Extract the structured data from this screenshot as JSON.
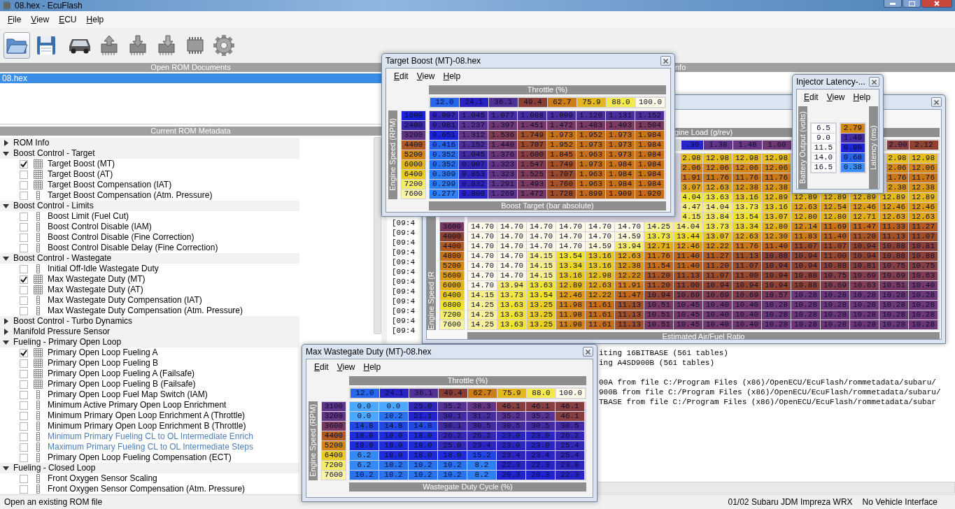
{
  "window": {
    "title": "08.hex - EcuFlash"
  },
  "menu": [
    "File",
    "View",
    "ECU",
    "Help"
  ],
  "documents": {
    "header": "Open ROM Documents",
    "items": [
      {
        "label": "08.hex",
        "selected": true
      }
    ]
  },
  "metadata": {
    "header": "Current ROM Metadata",
    "tree": [
      {
        "label": "ROM Info",
        "expanded": false
      },
      {
        "label": "Boost Control - Target",
        "expanded": true,
        "children": [
          {
            "label": "Target Boost (MT)",
            "checked": true,
            "kind": "grid",
            "highlighted": false
          },
          {
            "label": "Target Boost (AT)",
            "checked": false,
            "kind": "grid",
            "highlighted": false
          },
          {
            "label": "Target Boost Compensation (IAT)",
            "checked": false,
            "kind": "grid",
            "highlighted": false
          },
          {
            "label": "Target Boost Compensation (Atm. Pressure)",
            "checked": false,
            "kind": "column",
            "highlighted": false
          }
        ]
      },
      {
        "label": "Boost Control - Limits",
        "expanded": true,
        "children": [
          {
            "label": "Boost Limit (Fuel Cut)",
            "checked": false,
            "kind": "column",
            "highlighted": false
          },
          {
            "label": "Boost Control Disable (IAM)",
            "checked": false,
            "kind": "column",
            "highlighted": false
          },
          {
            "label": "Boost Control Disable (Fine Correction)",
            "checked": false,
            "kind": "column",
            "highlighted": false
          },
          {
            "label": "Boost Control Disable Delay (Fine Correction)",
            "checked": false,
            "kind": "column",
            "highlighted": false
          }
        ]
      },
      {
        "label": "Boost Control - Wastegate",
        "expanded": true,
        "children": [
          {
            "label": "Initial Off-Idle Wastegate Duty",
            "checked": false,
            "kind": "column",
            "highlighted": false
          },
          {
            "label": "Max Wastegate Duty (MT)",
            "checked": true,
            "kind": "grid",
            "highlighted": false
          },
          {
            "label": "Max Wastegate Duty (AT)",
            "checked": false,
            "kind": "grid",
            "highlighted": false
          },
          {
            "label": "Max Wastegate Duty Compensation (IAT)",
            "checked": false,
            "kind": "column",
            "highlighted": false
          },
          {
            "label": "Max Wastegate Duty Compensation (Atm. Pressure)",
            "checked": false,
            "kind": "column",
            "highlighted": false
          }
        ]
      },
      {
        "label": "Boost Control - Turbo Dynamics",
        "expanded": false
      },
      {
        "label": "Manifold Pressure Sensor",
        "expanded": false
      },
      {
        "label": "Fueling - Primary Open Loop",
        "expanded": true,
        "children": [
          {
            "label": "Primary Open Loop Fueling A",
            "checked": true,
            "kind": "grid",
            "highlighted": false
          },
          {
            "label": "Primary Open Loop Fueling B",
            "checked": false,
            "kind": "grid",
            "highlighted": false
          },
          {
            "label": "Primary Open Loop Fueling A (Failsafe)",
            "checked": false,
            "kind": "grid",
            "highlighted": false
          },
          {
            "label": "Primary Open Loop Fueling B (Failsafe)",
            "checked": false,
            "kind": "grid",
            "highlighted": false
          },
          {
            "label": "Primary Open Loop Fuel Map Switch (IAM)",
            "checked": false,
            "kind": "column",
            "highlighted": false
          },
          {
            "label": "Minimum Active Primary Open Loop Enrichment",
            "checked": false,
            "kind": "column",
            "highlighted": false
          },
          {
            "label": "Minimum Primary Open Loop Enrichment A (Throttle)",
            "checked": false,
            "kind": "column",
            "highlighted": false
          },
          {
            "label": "Minimum Primary Open Loop Enrichment B (Throttle)",
            "checked": false,
            "kind": "column",
            "highlighted": false
          },
          {
            "label": "Minimum Primary Fueling CL to OL Intermediate Enrich",
            "checked": false,
            "kind": "column",
            "highlighted": true
          },
          {
            "label": "Maximum Primary Fueling CL to OL Intermediate Steps",
            "checked": false,
            "kind": "column",
            "highlighted": true
          },
          {
            "label": "Primary Open Loop Fueling Compensation (ECT)",
            "checked": false,
            "kind": "column",
            "highlighted": false
          }
        ]
      },
      {
        "label": "Fueling - Closed Loop",
        "expanded": true,
        "children": [
          {
            "label": "Front Oxygen Sensor Scaling",
            "checked": false,
            "kind": "column",
            "highlighted": false
          },
          {
            "label": "Front Oxygen Sensor Compensation (Atm. Pressure)",
            "checked": false,
            "kind": "column",
            "highlighted": false
          }
        ]
      }
    ]
  },
  "right_pane": {
    "header": "nfo",
    "log_left": [
      "[09:4",
      "[09:4",
      "[09:4",
      "[09:4",
      "[09:4",
      "[09:4",
      "[09:4",
      "[09:4",
      "[09:4",
      "[09:4",
      "[09:4",
      "[09:4"
    ],
    "log_tail": [
      [
        "iting 16BITBASE (561 tables)",
        "ing A4SD900B (561 tables)"
      ],
      [
        "00A from file C:/Program Files (x86)/OpenECU/EcuFlash/rommetadata/subaru/",
        "900B from file C:/Program Files (x86)/OpenECU/EcuFlash/rommetadata/subaru/",
        "TBASE from file C:/Program Files (x86)/OpenECU/EcuFlash/rommetadata/subar"
      ]
    ]
  },
  "windows": [
    {
      "kind": "air-fuel-map",
      "x_axis": {
        "title": "gine Load (g/rev)",
        "values": [
          [
            ".30",
            "1.38",
            "1.48",
            "1.60"
          ],
          [
            "2.00",
            "2.12"
          ]
        ]
      },
      "y_axis": {
        "title": "Engine Speed (R",
        "values": [
          [
            "3600",
            "4000",
            "4400",
            "4800",
            "5200",
            "5600",
            "6000",
            "6400",
            "6800",
            "7200",
            "7600"
          ]
        ]
      },
      "data": {
        "title": "Estimated Air/Fuel Ratio",
        "rows": [
          [
            [
              "2.98",
              "12.98",
              "12.98",
              "12.98"
            ],
            [
              "2.98",
              "12.98"
            ]
          ],
          [
            [
              "2.06",
              "12.06",
              "12.06",
              "12.06"
            ],
            [
              "2.06",
              "12.06"
            ]
          ],
          [
            [
              "1.91",
              "11.76",
              "11.76",
              "11.76"
            ],
            [
              "1.76",
              "11.76"
            ]
          ],
          [
            [
              "3.07",
              "12.63",
              "12.38",
              "12.38"
            ],
            [
              "2.38",
              "12.38"
            ]
          ],
          [
            [
              "4.04",
              "13.63",
              "13.16",
              "12.89",
              "12.89",
              "12.89",
              "12.89",
              "12.89",
              "12.89"
            ]
          ],
          [
            [
              "4.47",
              "14.04",
              "13.73",
              "13.16",
              "12.63",
              "12.54",
              "12.46",
              "12.46",
              "12.46"
            ]
          ],
          [
            [
              "4.15",
              "13.84",
              "13.54",
              "13.07",
              "12.80",
              "12.80",
              "12.71",
              "12.63",
              "12.63"
            ]
          ],
          [
            [
              "14.70",
              "14.70",
              "14.70",
              "14.70",
              "14.70",
              "14.70",
              "14.25",
              "14.04",
              "13.73",
              "13.34",
              "12.80",
              "12.14",
              "11.69",
              "11.47",
              "11.33",
              "11.27"
            ]
          ],
          [
            [
              "14.70",
              "14.70",
              "14.70",
              "14.70",
              "14.70",
              "14.59",
              "13.73",
              "13.44",
              "13.07",
              "12.63",
              "12.30",
              "11.83",
              "11.40",
              "11.20",
              "11.13",
              "11.07"
            ]
          ],
          [
            [
              "14.70",
              "14.70",
              "14.70",
              "14.70",
              "14.59",
              "13.94",
              "12.71",
              "12.46",
              "12.22",
              "11.76",
              "11.40",
              "11.07",
              "11.07",
              "10.94",
              "10.88",
              "10.81"
            ]
          ],
          [
            [
              "14.70",
              "14.70",
              "14.15",
              "13.54",
              "13.16",
              "12.63",
              "11.76",
              "11.40",
              "11.27",
              "11.13",
              "10.88",
              "10.94",
              "11.00",
              "10.94",
              "10.88",
              "10.88"
            ]
          ],
          [
            [
              "14.70",
              "14.70",
              "14.15",
              "13.34",
              "13.16",
              "12.38",
              "11.54",
              "11.40",
              "11.20",
              "11.07",
              "10.94",
              "10.94",
              "10.88",
              "10.81",
              "10.75",
              "10.75"
            ]
          ],
          [
            [
              "14.70",
              "14.70",
              "14.15",
              "13.16",
              "12.98",
              "12.22",
              "11.20",
              "11.13",
              "11.07",
              "11.00",
              "10.94",
              "10.88",
              "10.75",
              "10.69",
              "10.69",
              "10.63"
            ]
          ],
          [
            [
              "14.70",
              "13.94",
              "13.63",
              "12.89",
              "12.63",
              "11.91",
              "11.20",
              "11.00",
              "10.94",
              "10.94",
              "10.94",
              "10.88",
              "10.69",
              "10.63",
              "10.51",
              "10.40"
            ]
          ],
          [
            [
              "14.15",
              "13.73",
              "13.54",
              "12.46",
              "12.22",
              "11.47",
              "10.94",
              "10.69",
              "10.69",
              "10.69",
              "10.57",
              "10.28",
              "10.28",
              "10.28",
              "10.28",
              "10.28"
            ]
          ],
          [
            [
              "14.25",
              "13.63",
              "13.25",
              "11.98",
              "11.61",
              "11.13",
              "10.51",
              "10.45",
              "10.40",
              "10.40",
              "10.28",
              "10.28",
              "10.28",
              "10.28",
              "10.28",
              "10.28"
            ]
          ],
          [
            [
              "14.25",
              "13.63",
              "13.25",
              "11.98",
              "11.61",
              "11.13",
              "10.51",
              "10.45",
              "10.40",
              "10.40",
              "10.28",
              "10.28",
              "10.28",
              "10.28",
              "10.28",
              "10.28"
            ]
          ],
          [
            [
              "14.25",
              "13.63",
              "13.25",
              "11.98",
              "11.61",
              "11.13",
              "10.51",
              "10.45",
              "10.40",
              "10.40",
              "10.28",
              "10.28",
              "10.28",
              "10.28",
              "10.28",
              "10.28"
            ]
          ]
        ]
      }
    },
    {
      "kind": "boost-map",
      "title": "Target Boost (MT)-08.hex",
      "menu": [
        "Edit",
        "View",
        "Help"
      ],
      "x_axis": {
        "title": "Throttle (%)",
        "values": [
          [
            "12.0",
            "24.1",
            "36.1",
            "49.4",
            "62.7",
            "75.9",
            "88.0",
            "100.0"
          ]
        ]
      },
      "y_axis": {
        "title": "Engine Speed (RPM)",
        "values": [
          [
            "1600",
            "2400",
            "3200",
            "4400",
            "5200",
            "6000",
            "6400",
            "7200",
            "7600"
          ]
        ]
      },
      "data": {
        "title": "Boost Target (bar absolute)",
        "rows": [
          [
            [
              "0.907",
              "1.045",
              "1.077",
              "1.088",
              "1.099",
              "1.120",
              "1.131",
              "1.152"
            ]
          ],
          [
            [
              "0.981",
              "1.237",
              "1.397",
              "1.451",
              "1.472",
              "1.483",
              "1.493",
              "1.504"
            ]
          ],
          [
            [
              "0.651",
              "1.312",
              "1.536",
              "1.749",
              "1.973",
              "1.952",
              "1.973",
              "1.984"
            ]
          ],
          [
            [
              "0.416",
              "1.152",
              "1.440",
              "1.707",
              "1.952",
              "1.973",
              "1.973",
              "1.984"
            ]
          ],
          [
            [
              "0.352",
              "1.045",
              "1.376",
              "1.600",
              "1.845",
              "1.963",
              "1.973",
              "1.984"
            ]
          ],
          [
            [
              "0.352",
              "0.907",
              "1.323",
              "1.547",
              "1.749",
              "1.973",
              "1.984",
              "1.984"
            ]
          ],
          [
            [
              "0.309",
              "0.853",
              "1.323",
              "1.525",
              "1.707",
              "1.963",
              "1.984",
              "1.984"
            ]
          ],
          [
            [
              "0.299",
              "0.832",
              "1.291",
              "1.493",
              "1.760",
              "1.963",
              "1.984",
              "1.984"
            ]
          ],
          [
            [
              "0.277",
              "0.800",
              "1.269",
              "1.472",
              "1.728",
              "1.899",
              "1.909",
              "1.920"
            ]
          ]
        ]
      }
    },
    {
      "kind": "latency-curve",
      "title": "Injector Latency-...",
      "menu": [
        "Edit",
        "View",
        "Help"
      ],
      "y_axis": {
        "title": "Battery Output (volts)",
        "values": [
          "6.5",
          "9.0",
          "11.5",
          "14.0",
          "16.5"
        ]
      },
      "data": {
        "title": "Latency (ms)",
        "values": [
          "2.79",
          "1.49",
          "0.98",
          "0.68",
          "0.38"
        ]
      }
    },
    {
      "kind": "duty-map",
      "title": "Max Wastegate Duty (MT)-08.hex",
      "menu": [
        "Edit",
        "View",
        "Help"
      ],
      "x_axis": {
        "title": "Throttle (%)",
        "values": [
          [
            "12.0",
            "24.1",
            "36.1",
            "49.4",
            "62.7",
            "75.9",
            "88.0",
            "100.0"
          ]
        ]
      },
      "y_axis": {
        "title": "Engine Speed (RPM)",
        "values": [
          [
            "3100",
            "3200",
            "3600",
            "4400",
            "5200",
            "6400",
            "7200",
            "7600"
          ]
        ]
      },
      "data": {
        "title": "Wastegate Duty Cycle (%)",
        "rows": [
          [
            [
              "0.0",
              "0.0",
              "25.0",
              "35.2",
              "38.3",
              "46.1",
              "46.1",
              "46.1"
            ]
          ],
          [
            [
              "0.0",
              "10.2",
              "21.1",
              "30.1",
              "31.2",
              "35.2",
              "35.2",
              "46.1"
            ]
          ],
          [
            [
              "14.8",
              "14.8",
              "14.8",
              "30.1",
              "30.5",
              "30.5",
              "30.5",
              "30.5"
            ]
          ],
          [
            [
              "18.0",
              "18.0",
              "18.0",
              "26.2",
              "26.2",
              "23.0",
              "23.0",
              "26.2"
            ]
          ],
          [
            [
              "18.0",
              "18.0",
              "18.0",
              "25.0",
              "23.4",
              "23.0",
              "23.0",
              "25.4"
            ]
          ],
          [
            [
              "6.2",
              "18.0",
              "18.0",
              "18.0",
              "15.2",
              "23.4",
              "23.4",
              "25.4"
            ]
          ],
          [
            [
              "6.2",
              "10.2",
              "10.2",
              "10.2",
              "8.2",
              "22.3",
              "22.3",
              "23.8"
            ]
          ],
          [
            [
              "10.2",
              "10.2",
              "10.2",
              "10.2",
              "8.2",
              "20.3",
              "20.3",
              "22.3"
            ]
          ]
        ]
      }
    }
  ],
  "status_bar": {
    "message": "Open an existing ROM file",
    "vehicle": "01/02 Subaru JDM Impreza WRX",
    "interface": "No Vehicle Interface"
  }
}
